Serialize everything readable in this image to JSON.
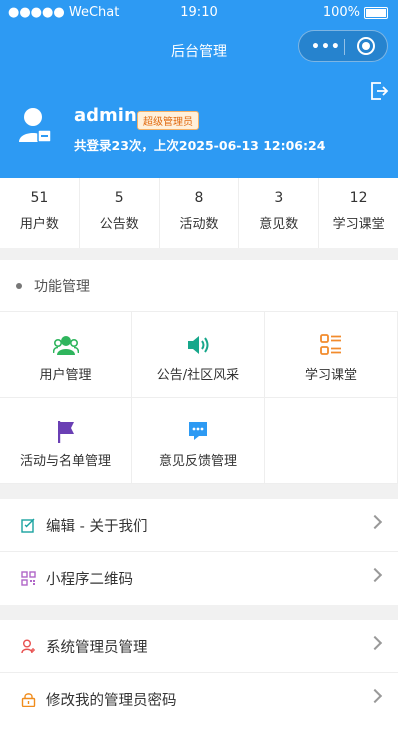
{
  "status_bar": {
    "carrier": "●●●●● WeChat",
    "time": "19:10",
    "battery": "100%"
  },
  "nav": {
    "title": "后台管理"
  },
  "user": {
    "name": "admin",
    "role": "超级管理员",
    "login_info": "共登录23次，上次2025-06-13 12:06:24"
  },
  "stats": [
    {
      "value": "51",
      "label": "用户数"
    },
    {
      "value": "5",
      "label": "公告数"
    },
    {
      "value": "8",
      "label": "活动数"
    },
    {
      "value": "3",
      "label": "意见数"
    },
    {
      "value": "12",
      "label": "学习课堂"
    }
  ],
  "functions": {
    "title": "功能管理",
    "items": [
      {
        "label": "用户管理",
        "icon": "users-icon",
        "color": "#2fb55d"
      },
      {
        "label": "公告/社区风采",
        "icon": "speaker-icon",
        "color": "#17a78b"
      },
      {
        "label": "学习课堂",
        "icon": "list-icon",
        "color": "#f28b2c"
      },
      {
        "label": "活动与名单管理",
        "icon": "flag-icon",
        "color": "#6a3fb4"
      },
      {
        "label": "意见反馈管理",
        "icon": "chat-icon",
        "color": "#2d9af3"
      }
    ]
  },
  "list1": [
    {
      "label": "编辑 - 关于我们",
      "icon": "edit-icon",
      "color": "#1aa2a0"
    },
    {
      "label": "小程序二维码",
      "icon": "qrcode-icon",
      "color": "#b067c8"
    }
  ],
  "list2": [
    {
      "label": "系统管理员管理",
      "icon": "admin-user-icon",
      "color": "#e8504f"
    },
    {
      "label": "修改我的管理员密码",
      "icon": "lock-icon",
      "color": "#f08c1c"
    }
  ],
  "colors": {
    "primary": "#2d9af3",
    "background": "#f1f1f1"
  }
}
